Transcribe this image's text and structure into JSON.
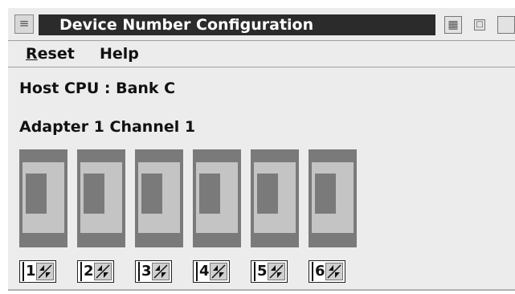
{
  "window": {
    "title": "Device Number Configuration",
    "system_menu_icon": "system-menu-icon",
    "minimize_icon": "minimize-icon",
    "restore_icon": "restore-icon",
    "maximize_icon": "maximize-icon"
  },
  "menubar": {
    "items": [
      {
        "label_first": "R",
        "label_rest": "eset"
      },
      {
        "label": "Help"
      }
    ]
  },
  "content": {
    "host_label": "Host CPU : Bank C",
    "adapter_label": "Adapter 1 Channel 1"
  },
  "devices": [
    {
      "number": "1"
    },
    {
      "number": "2"
    },
    {
      "number": "3"
    },
    {
      "number": "4"
    },
    {
      "number": "5"
    },
    {
      "number": "6"
    }
  ],
  "colors": {
    "title_bg": "#2b2b2b",
    "slot_outer": "#7a7a7a",
    "slot_inner": "#c4c4c4",
    "window_bg": "#ececec"
  }
}
